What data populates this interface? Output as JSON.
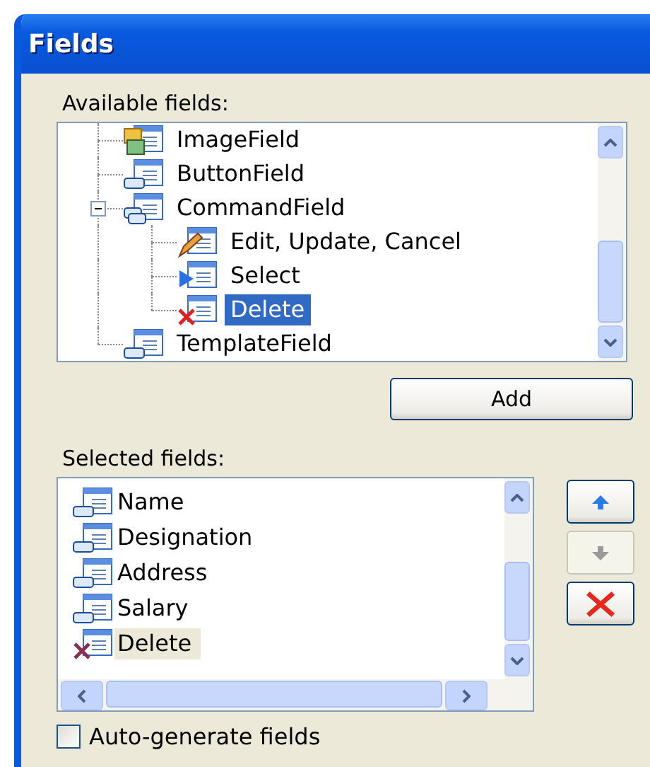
{
  "window": {
    "title": "Fields"
  },
  "available_fields": {
    "label": "Available fields:",
    "items": [
      {
        "label": "ImageField",
        "kind": "image",
        "selected": false
      },
      {
        "label": "ButtonField",
        "kind": "button",
        "selected": false
      },
      {
        "label": "CommandField",
        "kind": "command",
        "selected": false,
        "expanded": true,
        "children": [
          {
            "label": "Edit, Update, Cancel",
            "kind": "edit",
            "selected": false
          },
          {
            "label": "Select",
            "kind": "select",
            "selected": false
          },
          {
            "label": "Delete",
            "kind": "delete",
            "selected": true
          }
        ]
      },
      {
        "label": "TemplateField",
        "kind": "template",
        "selected": false
      }
    ]
  },
  "add_button": {
    "label": "Add"
  },
  "selected_fields": {
    "label": "Selected fields:",
    "items": [
      {
        "label": "Name",
        "kind": "bound",
        "selected": false
      },
      {
        "label": "Designation",
        "kind": "bound",
        "selected": false
      },
      {
        "label": "Address",
        "kind": "bound",
        "selected": false
      },
      {
        "label": "Salary",
        "kind": "bound",
        "selected": false
      },
      {
        "label": "Delete",
        "kind": "delete",
        "selected": true
      }
    ]
  },
  "side_buttons": [
    {
      "kind": "up",
      "disabled": false
    },
    {
      "kind": "down",
      "disabled": true
    },
    {
      "kind": "remove",
      "disabled": false
    }
  ],
  "auto_generate": {
    "label": "Auto-generate fields",
    "checked": false
  }
}
